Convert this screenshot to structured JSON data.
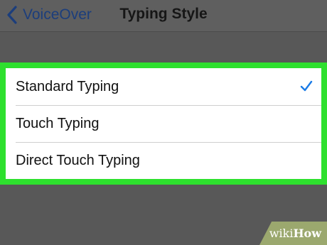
{
  "navbar": {
    "back_label": "VoiceOver",
    "back_icon": "chevron-left-icon",
    "title": "Typing Style"
  },
  "typing_options": [
    {
      "label": "Standard Typing",
      "selected": true
    },
    {
      "label": "Touch Typing",
      "selected": false
    },
    {
      "label": "Direct Touch Typing",
      "selected": false
    }
  ],
  "checkmark_icon": "checkmark-icon",
  "colors": {
    "highlight": "#2ee02e",
    "accent": "#1c3e7c",
    "checkmark": "#1a7be6",
    "background": "#585858"
  },
  "watermark": {
    "wiki": "wiki",
    "how": "How"
  }
}
